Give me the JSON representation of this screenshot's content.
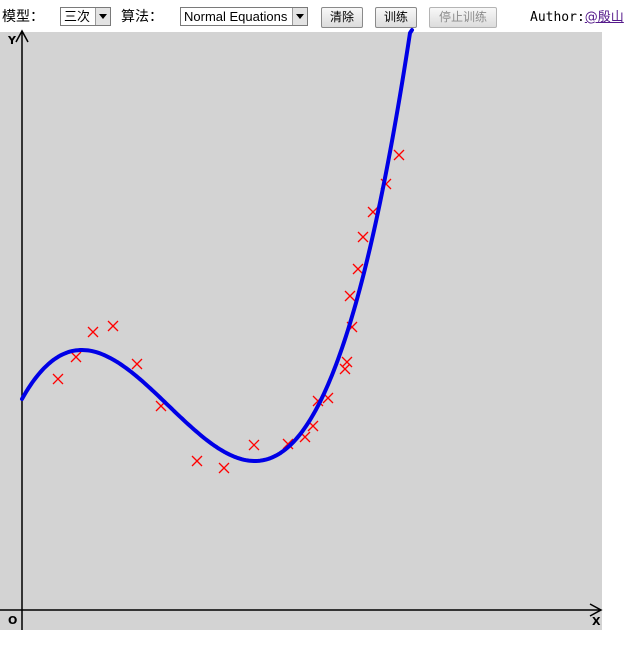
{
  "toolbar": {
    "model_label": "模型：",
    "model_value": "三次",
    "algorithm_label": "算法：",
    "algorithm_value": "Normal Equations",
    "clear_label": "清除",
    "train_label": "训练",
    "stop_label": "停止训练",
    "author_prefix": "Author:",
    "author_link": "@殷山"
  },
  "plot": {
    "y_axis_label": "Y",
    "x_axis_label": "X",
    "origin_label": "O"
  },
  "colors": {
    "plot_background": "#d3d3d3",
    "curve": "#0000e6",
    "points": "#ff0000",
    "axes": "#000000"
  }
}
